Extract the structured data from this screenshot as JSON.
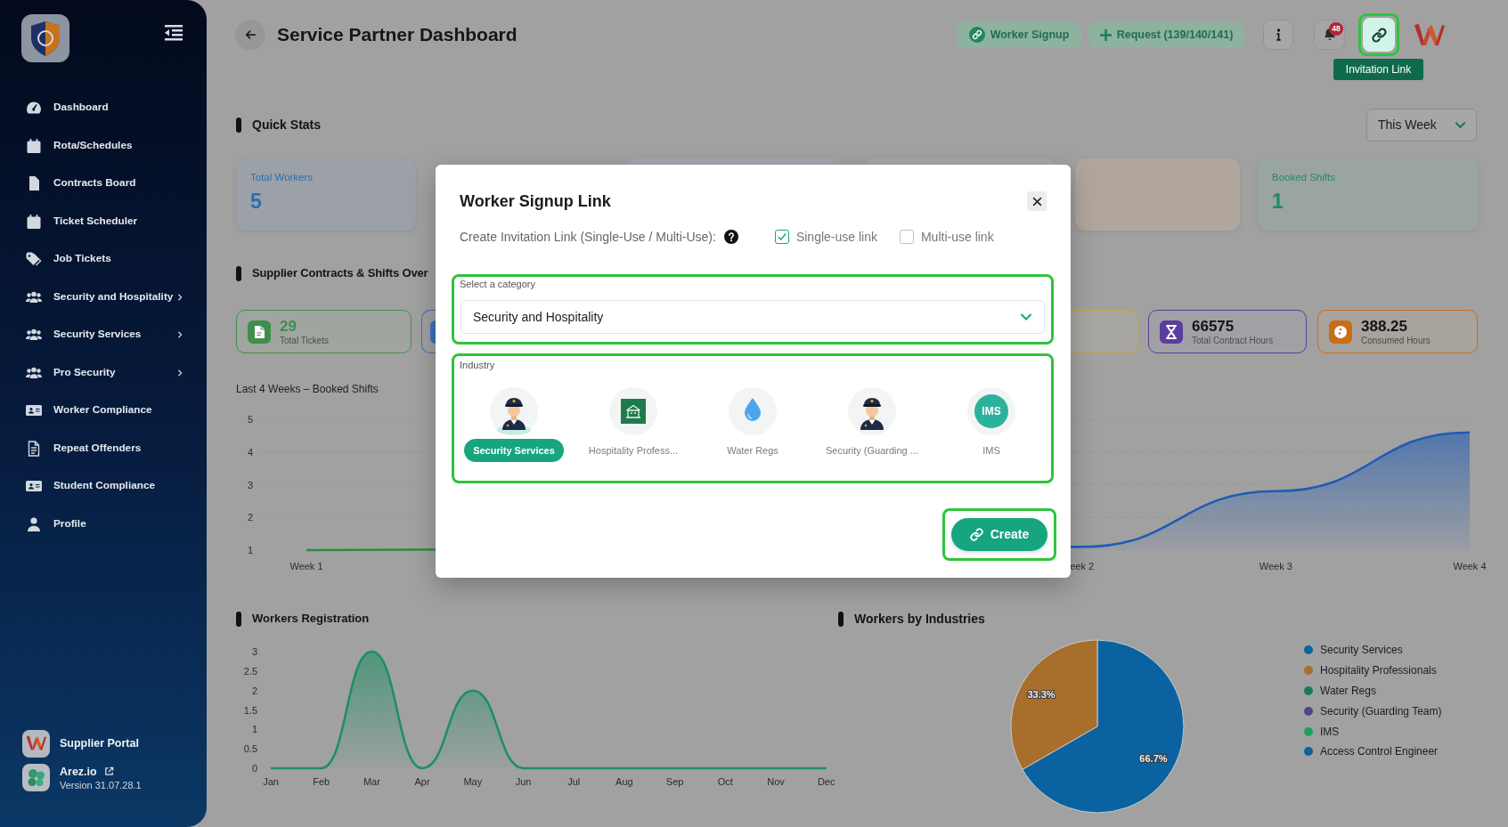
{
  "sidebar": {
    "items": [
      {
        "label": "Dashboard",
        "submenu": false
      },
      {
        "label": "Rota/Schedules",
        "submenu": false
      },
      {
        "label": "Contracts Board",
        "submenu": false
      },
      {
        "label": "Ticket Scheduler",
        "submenu": false
      },
      {
        "label": "Job Tickets",
        "submenu": false
      },
      {
        "label": "Security and Hospitality",
        "submenu": true
      },
      {
        "label": "Security Services",
        "submenu": true
      },
      {
        "label": "Pro Security",
        "submenu": true
      },
      {
        "label": "Worker Compliance",
        "submenu": false
      },
      {
        "label": "Repeat Offenders",
        "submenu": false
      },
      {
        "label": "Student Compliance",
        "submenu": false
      },
      {
        "label": "Profile",
        "submenu": false
      }
    ],
    "footer": [
      {
        "kind": "portal",
        "title": "Supplier Portal"
      },
      {
        "kind": "app",
        "title": "Arez.io",
        "subtitle": "Version 31.07.28.1"
      }
    ]
  },
  "header": {
    "title": "Service Partner Dashboard",
    "actions": [
      {
        "kind": "link",
        "label": "Worker Signup"
      },
      {
        "kind": "plus",
        "label": "Request (139/140/141)"
      }
    ],
    "notification_count": "48",
    "invitation_button": {
      "highlighted": true,
      "tooltip": "Invitation Link"
    }
  },
  "quick_stats": {
    "title": "Quick Stats",
    "period": "This Week",
    "cards": [
      {
        "kind": "full",
        "label": "Total Workers",
        "value": "5",
        "color": "#2b6db3"
      },
      {
        "kind": "edge",
        "color": "#aaa2b2"
      },
      {
        "kind": "edge",
        "color": "#a8a8a6"
      },
      {
        "kind": "blank",
        "color": "#b0a69c"
      },
      {
        "kind": "full",
        "label": "Booked Shifts",
        "value": "1",
        "color": "#1f8c62"
      }
    ]
  },
  "contracts": {
    "title": "Supplier Contracts & Shifts Over",
    "cards": [
      {
        "kind": "document",
        "value": "29",
        "label": "Total Tickets",
        "color": "#3f8f4a",
        "value_tinted": true
      },
      {
        "kind": "edge-left",
        "color": "#3a72be"
      },
      {
        "kind": "edge-right",
        "color": "#c8a23c"
      },
      {
        "kind": "hourglass",
        "value": "66575",
        "label": "Total Contract Hours",
        "color": "#5a3d9c",
        "value_tinted": false
      },
      {
        "kind": "timer",
        "value": "388.25",
        "label": "Consumed Hours",
        "color": "#c96d16",
        "value_tinted": false
      }
    ],
    "chart_data": {
      "type": "area",
      "title": "Last 4 Weeks – Booked Shifts",
      "categories": [
        "Week 1",
        null,
        null,
        null,
        "eek 2",
        "Week 3",
        "Week 4"
      ],
      "ylim": [
        1,
        5
      ],
      "yticks": [
        1,
        2,
        3,
        4,
        5
      ],
      "grid": true,
      "series": [
        {
          "color": "#1d5bb5",
          "values": [
            1,
            null,
            null,
            null,
            1.1,
            2.8,
            4.6
          ]
        }
      ]
    }
  },
  "workers_registration": {
    "title": "Workers Registration",
    "chart_data": {
      "type": "area",
      "categories": [
        "Jan",
        "Feb",
        "Mar",
        "Apr",
        "May",
        "Jun",
        "Jul",
        "Aug",
        "Sep",
        "Oct",
        "Nov",
        "Dec"
      ],
      "ylim": [
        0,
        3
      ],
      "yticks": [
        0,
        0.5,
        1,
        1.5,
        2,
        2.5,
        3
      ],
      "series": [
        {
          "color": "#1b8f63",
          "values": [
            0,
            0,
            3,
            0,
            2,
            0,
            0,
            0,
            0,
            0,
            0,
            0
          ]
        }
      ]
    }
  },
  "workers_by_industries": {
    "title": "Workers by Industries",
    "chart_data": {
      "type": "pie",
      "values": [
        66.7,
        33.3,
        0,
        0,
        0,
        0
      ],
      "value_labels": [
        "66.7%",
        "33.3%",
        null,
        null,
        null,
        null
      ]
    },
    "legend": [
      {
        "label": "Security Services",
        "color": "#0b62a0"
      },
      {
        "label": "Hospitality Professionals",
        "color": "#a86e2c"
      },
      {
        "label": "Water Regs",
        "color": "#1b7a55"
      },
      {
        "label": "Security (Guarding Team)",
        "color": "#4f4688"
      },
      {
        "label": "IMS",
        "color": "#1f9d62"
      },
      {
        "label": "Access Control Engineer",
        "color": "#0b62a0"
      }
    ]
  },
  "modal": {
    "title": "Worker Signup Link",
    "prompt": "Create Invitation Link (Single-Use / Multi-Use):",
    "link_types": [
      {
        "label": "Single-use link",
        "checked": true
      },
      {
        "label": "Multi-use link",
        "checked": false
      }
    ],
    "category": {
      "label": "Select a category",
      "value": "Security and Hospitality",
      "highlighted": true
    },
    "industry": {
      "label": "Industry",
      "highlighted": true,
      "options": [
        {
          "kind": "guard",
          "label": "Security Services",
          "selected": true
        },
        {
          "kind": "building",
          "label": "Hospitality Profess...",
          "selected": false
        },
        {
          "kind": "drop",
          "label": "Water Regs",
          "selected": false
        },
        {
          "kind": "guard",
          "label": "Security (Guarding ...",
          "selected": false
        },
        {
          "kind": "monogram",
          "badge": "IMS",
          "label": "IMS",
          "selected": false
        }
      ]
    },
    "create_button": {
      "label": "Create",
      "highlighted": true
    }
  }
}
